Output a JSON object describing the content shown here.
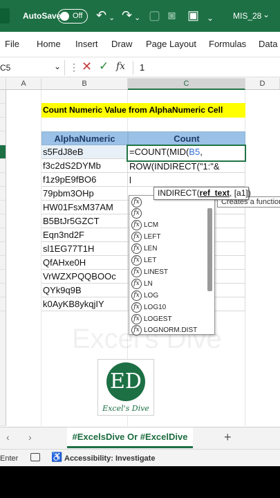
{
  "titlebar": {
    "autosave_label": "AutoSave",
    "autosave_state": "Off",
    "filename": "MIS_28",
    "accent": "#1d7044"
  },
  "ribbon": {
    "tabs": [
      "File",
      "Home",
      "Insert",
      "Draw",
      "Page Layout",
      "Formulas",
      "Data"
    ]
  },
  "formula_bar": {
    "name_box": "C5",
    "fx_label": "fx",
    "value": "1"
  },
  "columns": [
    "A",
    "B",
    "C",
    "D"
  ],
  "sheet": {
    "title": "Count Numeric Value from AlphaNumeric Cell",
    "header_alpha": "AlphaNumeric",
    "header_count": "Count",
    "values": [
      "s5FdJ8eB",
      "f3c2dS2DYMb",
      "f1z9pE9fBO6",
      "79pbm3OHp",
      "HW01FsxM37AM",
      "B5BtJr5GZCT",
      "Eqn3nd2F",
      "sl1EG77T1H",
      "QfAHxe0H",
      "VrWZXPQQBOOc",
      "QYk9q9B",
      "k0AyKB8ykqjIY"
    ],
    "formula_lines": {
      "line1_prefix": "=COUNT(MID(",
      "line1_ref": "B5",
      "line1_suffix": ",",
      "line2": "ROW(INDIRECT(\"1:\"&",
      "line3": "l"
    }
  },
  "tooltip": {
    "fn": "INDIRECT(",
    "arg1": "ref_text",
    "rest": ", [a1])",
    "secondary": "Creates a function"
  },
  "autocomplete": {
    "icon": "fx",
    "items": [
      "",
      "",
      "LCM",
      "LEFT",
      "LEN",
      "LET",
      "LINEST",
      "LN",
      "LOG",
      "LOG10",
      "LOGEST",
      "LOGNORM.DIST"
    ]
  },
  "watermark": {
    "text": "Excel's Dive",
    "logo_letters": "ED",
    "logo_name": "Excel's Dive"
  },
  "sheet_tabs": {
    "active": "#ExcelsDive Or #ExcelDive",
    "add": "+"
  },
  "statusbar": {
    "mode": "Enter",
    "accessibility": "Accessibility: Investigate"
  }
}
